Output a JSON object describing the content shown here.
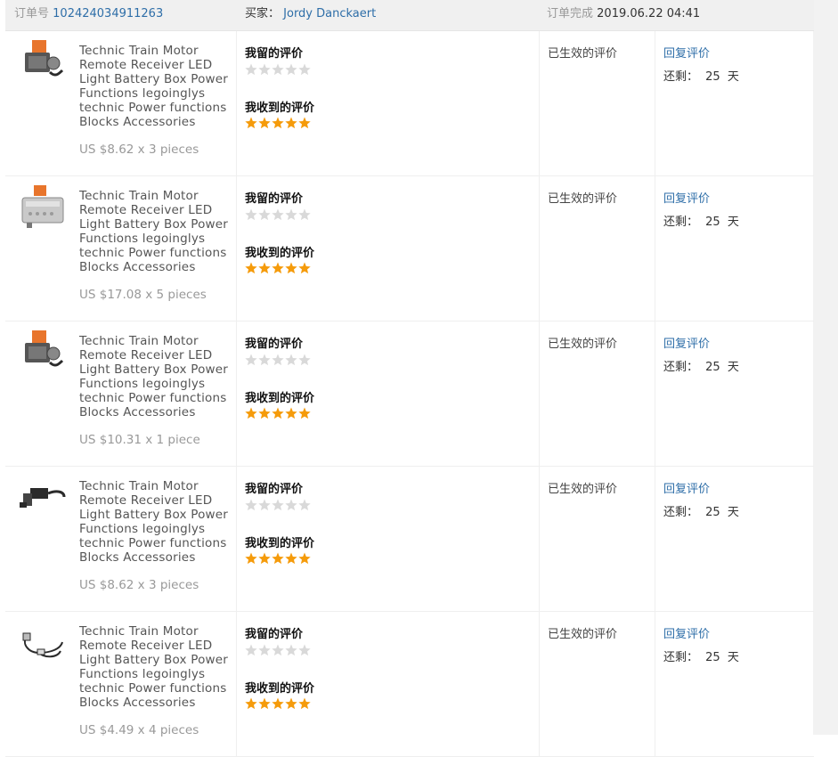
{
  "order": {
    "order_no_label": "订单号",
    "order_no": "102424034911263",
    "buyer_label": "买家：",
    "buyer": "Jordy Danckaert",
    "completed_label": "订单完成",
    "completed_time": "2019.06.22 04:41"
  },
  "labels": {
    "my_feedback": "我留的评价",
    "received_feedback": "我收到的评价",
    "status": "已生效的评价",
    "reply": "回复评价",
    "remaining": "还剩：",
    "days_left": "25",
    "days_unit": "天"
  },
  "colors": {
    "link": "#2e6ea8",
    "star_filled": "#f59b0b",
    "star_empty": "#d9d9d9",
    "header_bg": "#f0f0f0"
  },
  "items": [
    {
      "title_lines": [
        "Technic Train Motor",
        "Remote Receiver LED",
        "Light Battery Box Power",
        "Functions legoinglys",
        "technic Power functions",
        "Blocks Accessories"
      ],
      "price": "US $8.62 x 3 pieces",
      "my_rating": 0,
      "received_rating": 5,
      "thumb": "motor-icon"
    },
    {
      "title_lines": [
        "Technic Train Motor",
        "Remote Receiver LED",
        "Light Battery Box Power",
        "Functions legoinglys",
        "technic Power functions",
        "Blocks Accessories"
      ],
      "price": "US $17.08 x 5 pieces",
      "my_rating": 0,
      "received_rating": 5,
      "thumb": "battery-box-icon"
    },
    {
      "title_lines": [
        "Technic Train Motor",
        "Remote Receiver LED",
        "Light Battery Box Power",
        "Functions legoinglys",
        "technic Power functions",
        "Blocks Accessories"
      ],
      "price": "US $10.31 x 1 piece",
      "my_rating": 0,
      "received_rating": 5,
      "thumb": "motor-icon"
    },
    {
      "title_lines": [
        "Technic Train Motor",
        "Remote Receiver LED",
        "Light Battery Box Power",
        "Functions legoinglys",
        "technic Power functions",
        "Blocks Accessories"
      ],
      "price": "US $8.62 x 3 pieces",
      "my_rating": 0,
      "received_rating": 5,
      "thumb": "cable-icon"
    },
    {
      "title_lines": [
        "Technic Train Motor",
        "Remote Receiver LED",
        "Light Battery Box Power",
        "Functions legoinglys",
        "technic Power functions",
        "Blocks Accessories"
      ],
      "price": "US $4.49 x 4 pieces",
      "my_rating": 0,
      "received_rating": 5,
      "thumb": "led-light-icon"
    }
  ]
}
